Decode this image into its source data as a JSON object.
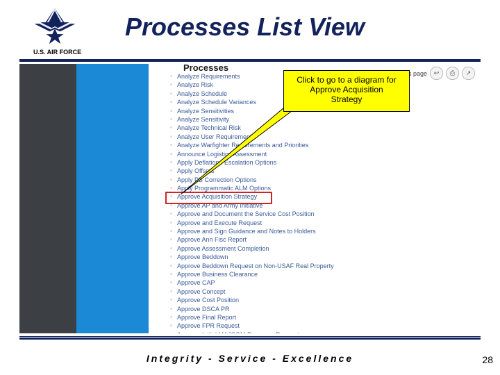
{
  "header": {
    "title": "Processes List View",
    "brand": "U.S. AIR FORCE"
  },
  "callout": {
    "line1": "Click to go to a diagram for",
    "line2": "Approve Acquisition",
    "line3": "Strategy"
  },
  "panel": {
    "heading": "Processes",
    "toolbar_label": "ent of this page"
  },
  "list": {
    "highlight_index": 14,
    "items": [
      "Analyze Requirements",
      "Analyze Risk",
      "Analyze Schedule",
      "Analyze Schedule Variances",
      "Analyze Sensitivities",
      "Analyze Sensitivity",
      "Analyze Technical Risk",
      "Analyze User Requirements",
      "Analyze Warfighter Requirements and Priorities",
      "Announce Logistics Assessment",
      "Apply Deflation / Escalation Options",
      "Apply Offsets",
      "Apply PB Correction Options",
      "Apply Programmatic ALM Options",
      "Approve Acquisition Strategy",
      "Approve AP and Army Initiative",
      "Approve and Document the Service Cost Position",
      "Approve and Execute Request",
      "Approve and Sign Guidance and Notes to Holders",
      "Approve Ann Fisc Report",
      "Approve Assessment Completion",
      "Approve Beddown",
      "Approve Beddown Request on Non-USAF Real Property",
      "Approve Business Clearance",
      "Approve CAP",
      "Approve Concept",
      "Approve Cost Position",
      "Approve DSCA PR",
      "Approve Final Report",
      "Approve FPR Request",
      "Approve Initial MAJCOM Resource Request"
    ]
  },
  "footer": {
    "motto": "Integrity - Service - Excellence",
    "page": "28"
  },
  "icons": {
    "back": "↩",
    "print": "⎙",
    "ext": "↗"
  }
}
